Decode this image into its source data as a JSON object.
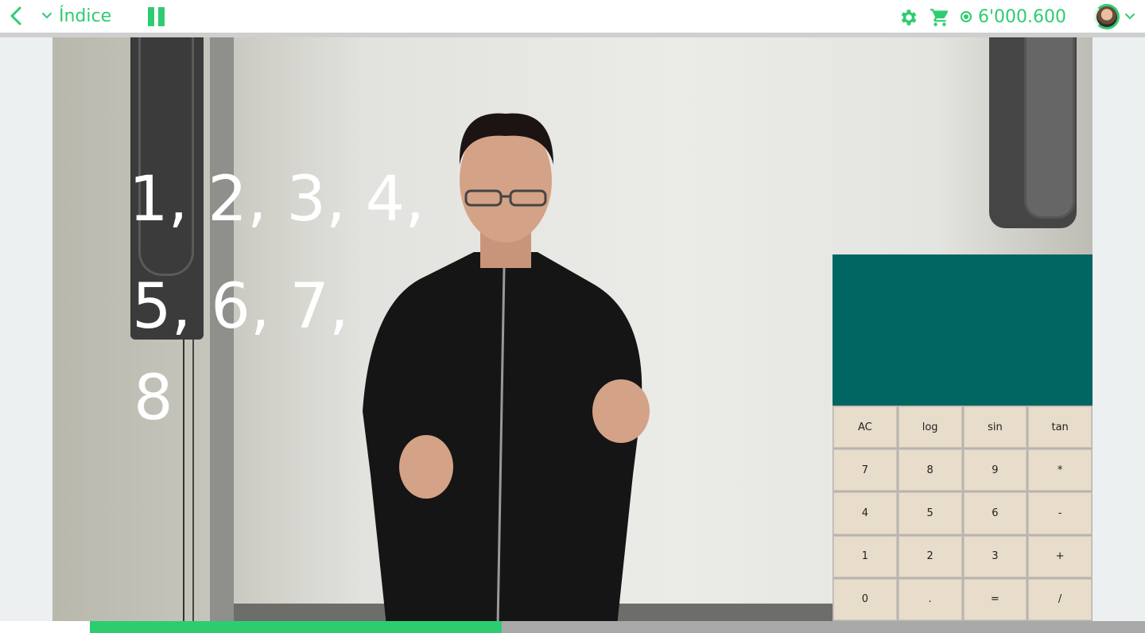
{
  "header": {
    "index_label": "Índice",
    "coins_value": "6'000.600",
    "accent_color": "#2ecc71",
    "icons": [
      "chevron-left-icon",
      "chevron-down-icon",
      "pause-icon",
      "gear-icon",
      "cart-icon",
      "coin-icon",
      "avatar",
      "chevron-down-icon"
    ]
  },
  "video": {
    "board_lines": [
      "1, 2, 3, 4,",
      "5, 6, 7,",
      "8"
    ]
  },
  "calculator": {
    "display_value": "",
    "display_color": "#016562",
    "key_color": "#e8dccb",
    "keys": [
      "AC",
      "log",
      "sin",
      "tan",
      "7",
      "8",
      "9",
      "*",
      "4",
      "5",
      "6",
      "-",
      "1",
      "2",
      "3",
      "+",
      "0",
      ".",
      "=",
      "/"
    ]
  },
  "playback": {
    "progress_fraction": 0.39
  }
}
